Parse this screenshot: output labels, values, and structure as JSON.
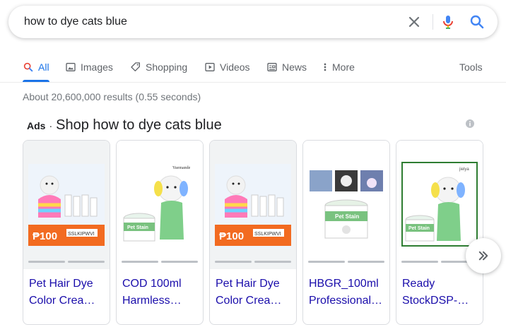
{
  "search": {
    "query": "how to dye cats blue"
  },
  "tabs": [
    {
      "label": "All",
      "icon": "search-icon"
    },
    {
      "label": "Images",
      "icon": "image-icon"
    },
    {
      "label": "Shopping",
      "icon": "tag-icon"
    },
    {
      "label": "Videos",
      "icon": "play-icon"
    },
    {
      "label": "News",
      "icon": "news-icon"
    },
    {
      "label": "More",
      "icon": "more-vert-icon"
    },
    {
      "label": "Tools"
    }
  ],
  "stats": "About 20,600,000 results (0.55 seconds)",
  "ads": {
    "label": "Ads",
    "separator": "·",
    "title": "Shop how to dye cats blue"
  },
  "products": [
    {
      "line1": "Pet Hair Dye",
      "line2": "Color Crea…",
      "img_text": "₱100",
      "img_code": "SSLKIPWVI"
    },
    {
      "line1": "COD 100ml",
      "line2": "Harmless…",
      "img_brand": "Yuemande",
      "img_label": "Pet Stain"
    },
    {
      "line1": "Pet Hair Dye",
      "line2": "Color Crea…",
      "img_text": "₱100",
      "img_code": "SSLKIPWVI"
    },
    {
      "line1": "HBGR_100ml",
      "line2": "Professional…",
      "img_label": "Pet Stain"
    },
    {
      "line1": "Ready",
      "line2": "StockDSP-…",
      "img_brand": "jielya",
      "img_label": "Pet Stain"
    }
  ],
  "colors": {
    "accent": "#1a73e8",
    "link": "#1a0dab",
    "muted": "#70757a"
  }
}
